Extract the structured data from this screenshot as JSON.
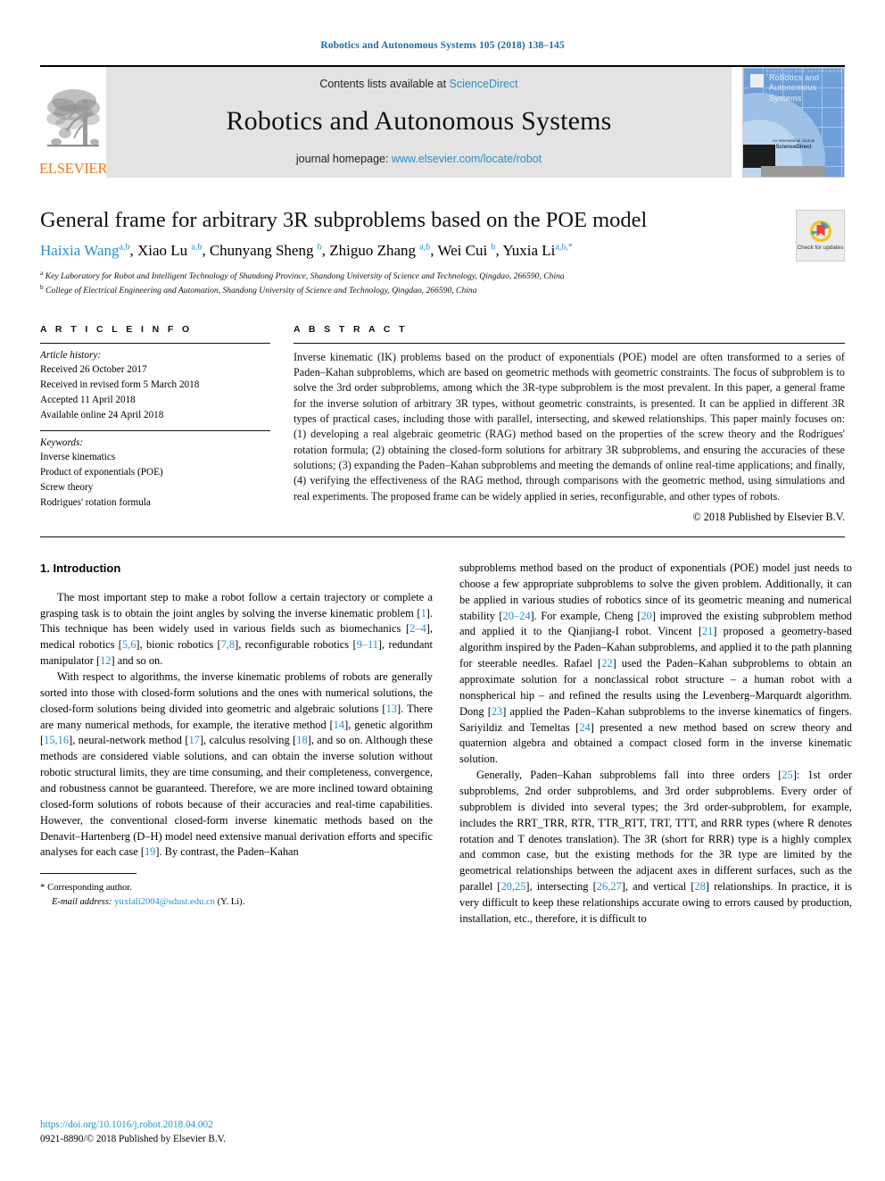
{
  "running_head": "Robotics and Autonomous Systems 105 (2018) 138–145",
  "masthead": {
    "publisher_logo_text": "ELSEVIER",
    "contents_prefix": "Contents lists available at ",
    "contents_link": "ScienceDirect",
    "journal_title": "Robotics and Autonomous Systems",
    "homepage_prefix": "journal homepage: ",
    "homepage_link": "www.elsevier.com/locate/robot",
    "cover": {
      "line1": "Robotics and",
      "line2": "Autonomous Systems",
      "tiny_top": "ROBOTICS   AND   AUTONOMOUS   SYSTEMS",
      "foot_small": "An International Journal",
      "foot_bold": "ScienceDirect"
    }
  },
  "article": {
    "title": "General frame for arbitrary 3R subproblems based on the POE model",
    "authors": [
      {
        "name": "Haixia Wang",
        "sup": "a,b",
        "first": true
      },
      {
        "name": "Xiao Lu",
        "sup": "a,b",
        "first": false
      },
      {
        "name": "Chunyang Sheng",
        "sup": "b",
        "first": false
      },
      {
        "name": "Zhiguo Zhang",
        "sup": "a,b",
        "first": false
      },
      {
        "name": "Wei Cui",
        "sup": "b",
        "first": false
      },
      {
        "name": "Yuxia Li",
        "sup": "a,b,*",
        "first": false
      }
    ],
    "affiliations": [
      {
        "mark": "a",
        "text": "Key Laboratory for Robot and Intelligent Technology of Shandong Province, Shandong University of Science and Technology, Qingdao, 266590, China"
      },
      {
        "mark": "b",
        "text": "College of Electrical Engineering and Automation, Shandong University of Science and Technology, Qingdao, 266590, China"
      }
    ],
    "crossmark_label": "Check for updates"
  },
  "info": {
    "heading": "A R T I C L E  I N F O",
    "history_label": "Article history:",
    "history": [
      "Received 26 October 2017",
      "Received in revised form 5 March 2018",
      "Accepted 11 April 2018",
      "Available online 24 April 2018"
    ],
    "keywords_label": "Keywords:",
    "keywords": [
      "Inverse kinematics",
      "Product of exponentials (POE)",
      "Screw theory",
      "Rodrigues' rotation formula"
    ]
  },
  "abstract": {
    "heading": "A B S T R A C T",
    "text": "Inverse kinematic (IK) problems based on the product of exponentials (POE) model are often transformed to a series of Paden–Kahan subproblems, which are based on geometric methods with geometric constraints. The focus of subproblem is to solve the 3rd order subproblems, among which the 3R-type subproblem is the most prevalent. In this paper, a general frame for the inverse solution of arbitrary 3R types, without geometric constraints, is presented. It can be applied in different 3R types of practical cases, including those with parallel, intersecting, and skewed relationships. This paper mainly focuses on: (1) developing a real algebraic geometric (RAG) method based on the properties of the screw theory and the Rodrigues' rotation formula; (2) obtaining the closed-form solutions for arbitrary 3R subproblems, and ensuring the accuracies of these solutions; (3) expanding the Paden–Kahan subproblems and meeting the demands of online real-time applications; and finally, (4) verifying the effectiveness of the RAG method, through comparisons with the geometric method, using simulations and real experiments. The proposed frame can be widely applied in series, reconfigurable, and other types of robots.",
    "copyright": "© 2018 Published by Elsevier B.V."
  },
  "body": {
    "section_number_title": "1. Introduction",
    "left_paragraphs": [
      "The most important step to make a robot follow a certain trajectory or complete a grasping task is to obtain the joint angles by solving the inverse kinematic problem [1]. This technique has been widely used in various fields such as biomechanics [2–4], medical robotics [5,6], bionic robotics [7,8], reconfigurable robotics [9–11], redundant manipulator [12] and so on.",
      "With respect to algorithms, the inverse kinematic problems of robots are generally sorted into those with closed-form solutions and the ones with numerical solutions, the closed-form solutions being divided into geometric and algebraic solutions [13]. There are many numerical methods, for example, the iterative method [14], genetic algorithm [15,16], neural-network method [17], calculus resolving [18], and so on. Although these methods are considered viable solutions, and can obtain the inverse solution without robotic structural limits, they are time consuming, and their completeness, convergence, and robustness cannot be guaranteed. Therefore, we are more inclined toward obtaining closed-form solutions of robots because of their accuracies and real-time capabilities. However, the conventional closed-form inverse kinematic methods based on the Denavit–Hartenberg (D–H) model need extensive manual derivation efforts and specific analyses for each case [19]. By contrast, the Paden–Kahan"
    ],
    "right_paragraphs": [
      "subproblems method based on the product of exponentials (POE) model just needs to choose a few appropriate subproblems to solve the given problem. Additionally, it can be applied in various studies of robotics since of its geometric meaning and numerical stability [20–24]. For example, Cheng [20] improved the existing subproblem method and applied it to the Qianjiang-I robot. Vincent [21] proposed a geometry-based algorithm inspired by the Paden–Kahan subproblems, and applied it to the path planning for steerable needles. Rafael [22] used the Paden–Kahan subproblems to obtain an approximate solution for a nonclassical robot structure – a human robot with a nonspherical hip – and refined the results using the Levenberg–Marquardt algorithm. Dong [23] applied the Paden–Kahan subproblems to the inverse kinematics of fingers. Sariyildiz and Temeltas [24] presented a new method based on screw theory and quaternion algebra and obtained a compact closed form in the inverse kinematic solution.",
      "Generally, Paden–Kahan subproblems fall into three orders [25]: 1st order subproblems, 2nd order subproblems, and 3rd order subproblems. Every order of subproblem is divided into several types; the 3rd order-subproblem, for example, includes the RRT_TRR, RTR, TTR_RTT, TRT, TTT, and RRR types (where R denotes rotation and T denotes translation). The 3R (short for RRR) type is a highly complex and common case, but the existing methods for the 3R type are limited by the geometrical relationships between the adjacent axes in different surfaces, such as the parallel [20,25], intersecting [26,27], and vertical [28] relationships. In practice, it is very difficult to keep these relationships accurate owing to errors caused by production, installation, etc., therefore, it is difficult to"
    ],
    "footnote": {
      "star": "*",
      "corresponding": "Corresponding author.",
      "email_label": "E-mail address:",
      "email": "yuxiali2004@sdust.edu.cn",
      "email_suffix": "(Y. Li)."
    }
  },
  "page_footer": {
    "doi": "https://doi.org/10.1016/j.robot.2018.04.002",
    "issn_line": "0921-8890/© 2018 Published by Elsevier B.V."
  },
  "colors": {
    "link": "#2a8fc4",
    "running_head": "#1a6fa8",
    "elsevier_orange": "#ef7d22",
    "masthead_bg": "#e3e3e3"
  }
}
